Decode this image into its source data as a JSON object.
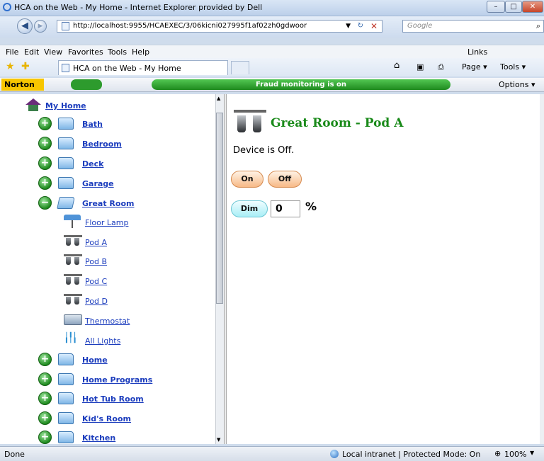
{
  "window": {
    "title": "HCA on the Web - My Home - Internet Explorer provided by Dell",
    "min": "–",
    "max": "□",
    "close": "✕"
  },
  "addressbar": {
    "url": "http://localhost:9955/HCAEXEC/3/06kicni027995f1af02zh0gdwoor",
    "search_placeholder": "Google",
    "back": "◀",
    "forward": "▶"
  },
  "menu": {
    "file": "File",
    "edit": "Edit",
    "view": "View",
    "favorites": "Favorites",
    "tools": "Tools",
    "help": "Help",
    "links": "Links"
  },
  "tab": {
    "title": "HCA on the Web - My Home"
  },
  "commandbar": {
    "page": "Page ▾",
    "tools": "Tools ▾"
  },
  "norton": {
    "logo": "Norton",
    "fraud": "Fraud monitoring is on",
    "options": "Options ▾"
  },
  "tree": {
    "root": "My Home",
    "bath": "Bath",
    "bedroom": "Bedroom",
    "deck": "Deck",
    "garage": "Garage",
    "great_room": "Great Room",
    "floor_lamp": "Floor Lamp",
    "pod_a": "Pod A",
    "pod_b": "Pod B",
    "pod_c": "Pod C",
    "pod_d": "Pod D",
    "thermostat": "Thermostat",
    "all_lights": "All Lights",
    "home": "Home",
    "home_programs": "Home Programs",
    "hot_tub_room": "Hot Tub Room",
    "kids_room": "Kid's Room",
    "kitchen": "Kitchen"
  },
  "device": {
    "title": "Great Room - Pod A",
    "status": "Device is Off.",
    "on": "On",
    "off": "Off",
    "dim": "Dim",
    "dim_value": "0",
    "pct": "%"
  },
  "statusbar": {
    "left": "Done",
    "zone": "Local intranet | Protected Mode: On",
    "zoom": "100%"
  }
}
